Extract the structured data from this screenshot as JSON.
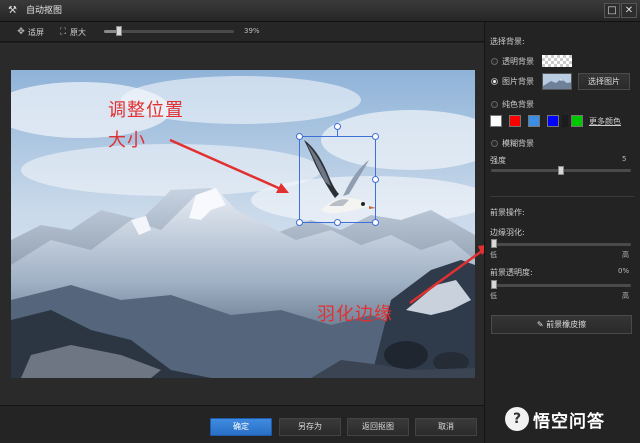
{
  "window": {
    "title": "自动抠图",
    "tool_icon": "wand-icon",
    "max_glyph": "□",
    "close_glyph": "✕"
  },
  "toolbar": {
    "fit_label": "适屏",
    "original_label": "原大",
    "zoom_text": "39%",
    "zoom_fraction": 0.1
  },
  "canvas": {
    "annotations": {
      "line1": "调整位置",
      "line2": "大小",
      "feather": "羽化边缘"
    },
    "accent": "#e23030",
    "selection_color": "#3f6fd8"
  },
  "bottom": {
    "confirm": "确定",
    "save_as": "另存为",
    "back": "返回抠图",
    "cancel": "取消"
  },
  "panel": {
    "bg_heading": "选择背景:",
    "transparent_bg": "透明背景",
    "image_bg": "图片背景",
    "choose_image": "选择图片",
    "solid_bg": "纯色背景",
    "swatches": [
      "#ffffff",
      "#ff0000",
      "#3a8ee6",
      "#0000ff",
      "#1c1c1c",
      "#00c800"
    ],
    "more_colors": "更多颜色",
    "blur_bg": "模糊背景",
    "strength_label": "强度",
    "strength_value": "5",
    "strength_fraction": 0.5,
    "fg_heading": "前景操作:",
    "edge_feather": "边缘羽化:",
    "low1": "低",
    "high1": "高",
    "feather_fraction": 0.0,
    "fg_opacity": "前景透明度:",
    "fg_opacity_value": "0%",
    "low2": "低",
    "high2": "高",
    "opacity_fraction": 0.0,
    "eraser": "前景橡皮擦"
  },
  "watermark": {
    "text": "悟空问答"
  }
}
